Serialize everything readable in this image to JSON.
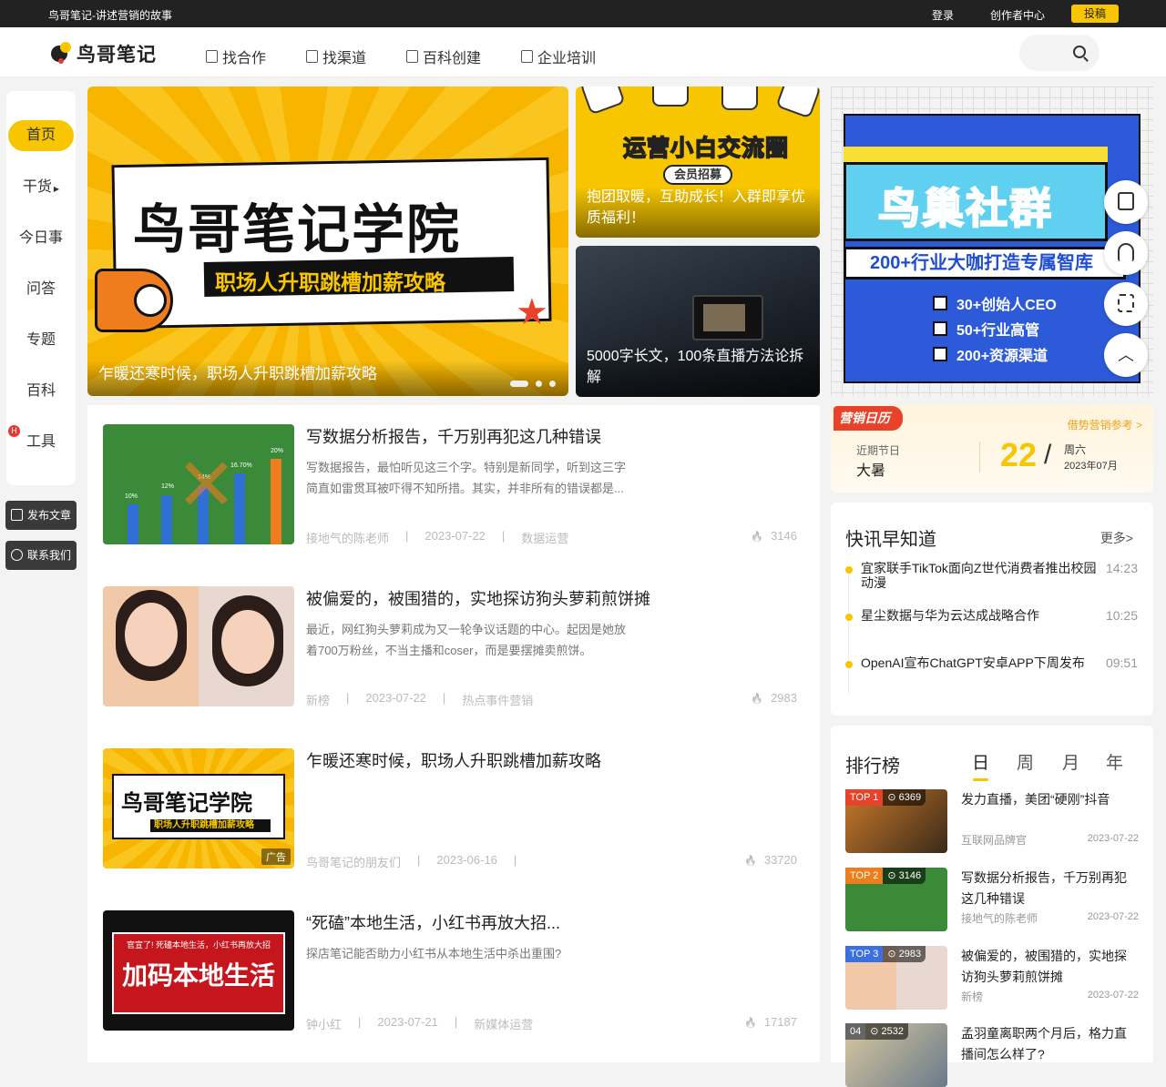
{
  "topbar": {
    "slogan": "鸟哥笔记-讲述营销的故事",
    "login": "登录",
    "creator": "创作者中心",
    "post": "投稿"
  },
  "header": {
    "logo": "鸟哥笔记",
    "nav": [
      {
        "label": "找合作",
        "icon": "cooperation-icon"
      },
      {
        "label": "找渠道",
        "icon": "channel-icon"
      },
      {
        "label": "百科创建",
        "icon": "wiki-icon"
      },
      {
        "label": "企业培训",
        "icon": "training-icon"
      }
    ]
  },
  "leftnav": {
    "items": [
      "首页",
      "干货",
      "今日事",
      "问答",
      "专题",
      "百科",
      "工具"
    ],
    "hot": "H",
    "publish": "发布文章",
    "contact": "联系我们"
  },
  "slides": {
    "hero": {
      "title": "鸟哥笔记学院",
      "sub": "职场人升职跳槽加薪攻略",
      "caption": "乍暖还寒时候，职场人升职跳槽加薪攻略"
    },
    "s2": {
      "title": "运营小白交流圈",
      "tag": "会员招募",
      "caption": "抱团取暖，互助成长！入群即享优质福利！"
    },
    "s3": {
      "caption": "5000字长文，100条直播方法论拆解"
    },
    "s4": {
      "title": "鸟巢社群",
      "sub": "200+行业大咖打造专属智库",
      "points": [
        "30+创始人CEO",
        "50+行业高管",
        "200+资源渠道"
      ]
    }
  },
  "calendar": {
    "tag": "营销日历",
    "ref": "借势营销参考 >",
    "near_label": "近期节日",
    "festival": "大暑",
    "day": "22",
    "slash": "/",
    "weekday": "周六",
    "yearmonth": "2023年07月"
  },
  "news": {
    "title": "快讯早知道",
    "more": "更多>",
    "items": [
      {
        "text": "宜家联手TikTok面向Z世代消费者推出校园动漫",
        "time": "14:23"
      },
      {
        "text": "星尘数据与华为云达成战略合作",
        "time": "10:25"
      },
      {
        "text": "OpenAI宣布ChatGPT安卓APP下周发布",
        "time": "09:51"
      }
    ]
  },
  "rank": {
    "title": "排行榜",
    "tabs": [
      "日",
      "周",
      "月",
      "年"
    ],
    "items": [
      {
        "badge": "TOP 1",
        "views": "6369",
        "title": "发力直播，美团“硬刚”抖音",
        "author": "互联网品牌官",
        "date": "2023-07-22",
        "color": "#e8432a"
      },
      {
        "badge": "TOP 2",
        "views": "3146",
        "title": "写数据分析报告，千万别再犯这几种错误",
        "author": "接地气的陈老师",
        "date": "2023-07-22",
        "color": "#f07d1d"
      },
      {
        "badge": "TOP 3",
        "views": "2983",
        "title": "被偏爱的，被围猎的，实地探访狗头萝莉煎饼摊",
        "author": "新榜",
        "date": "2023-07-22",
        "color": "#3c6fe0"
      },
      {
        "badge": "04",
        "views": "2532",
        "title": "孟羽童离职两个月后，格力直播间怎么样了?",
        "author": "",
        "date": "",
        "color": "#555"
      }
    ]
  },
  "articles": [
    {
      "title": "写数据分析报告，千万别再犯这几种错误",
      "desc": "写数据报告，最怕听见这三个字。特别是新同学，听到这三字简直如雷贯耳被吓得不知所措。其实，并非所有的错误都是...",
      "author": "接地气的陈老师",
      "date": "2023-07-22",
      "category": "数据运营",
      "views": "3146",
      "chart_labels": [
        "10%",
        "12%",
        "14%",
        "16.70%",
        "20%"
      ]
    },
    {
      "title": "被偏爱的，被围猎的，实地探访狗头萝莉煎饼摊",
      "desc": "最近，网红狗头萝莉成为又一轮争议话题的中心。起因是她放着700万粉丝，不当主播和coser，而是要摆摊卖煎饼。",
      "author": "新榜",
      "date": "2023-07-22",
      "category": "热点事件营销",
      "views": "2983"
    },
    {
      "title": "乍暖还寒时候，职场人升职跳槽加薪攻略",
      "desc": "",
      "author": "鸟哥笔记的朋友们",
      "date": "2023-06-16",
      "category": "",
      "views": "33720",
      "ad": "广告",
      "img_title": "鸟哥笔记学院",
      "img_sub": "职场人升职跳槽加薪攻略"
    },
    {
      "title": "“死磕”本地生活，小红书再放大招...",
      "desc": "探店笔记能否助力小红书从本地生活中杀出重围?",
      "author": "钟小红",
      "date": "2023-07-21",
      "category": "新媒体运营",
      "views": "17187",
      "img_small": "官宣了! 死磕本地生活，小红书再放大招",
      "img_big": "加码本地生活"
    }
  ]
}
